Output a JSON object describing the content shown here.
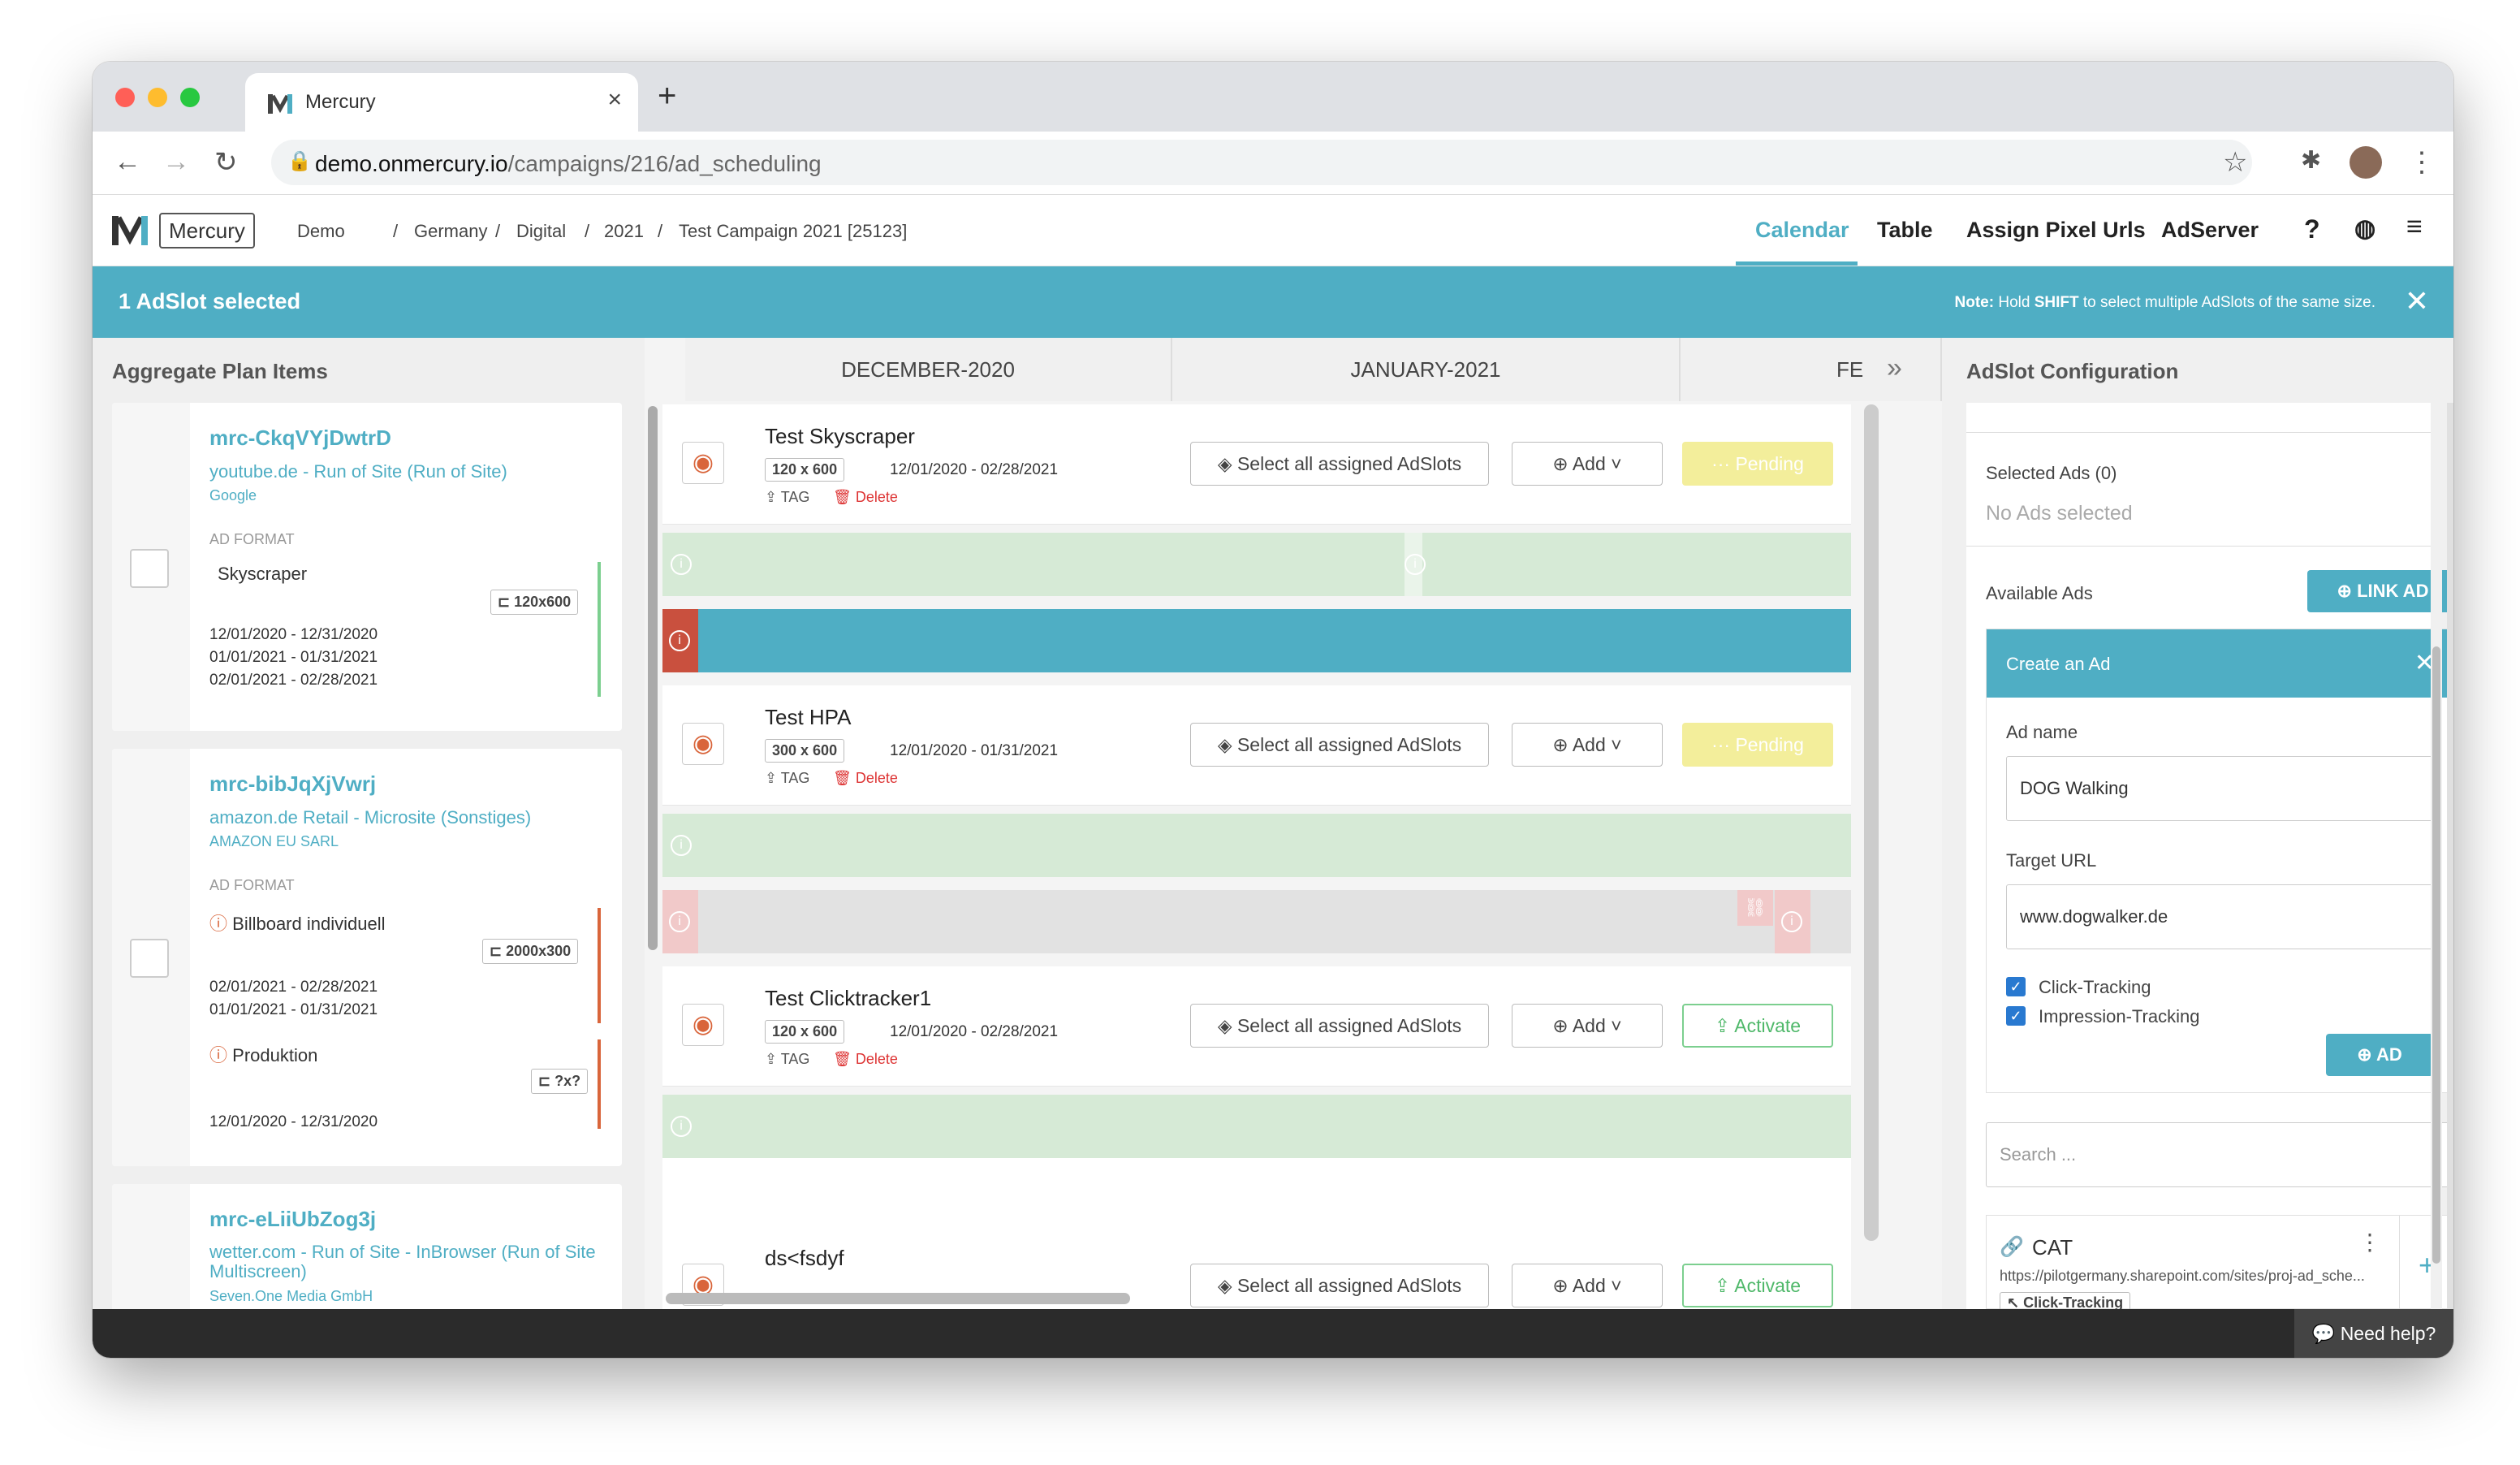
{
  "browser": {
    "tab_title": "Mercury",
    "url_domain": "demo.onmercury.io",
    "url_path": "/campaigns/216/ad_scheduling"
  },
  "app": {
    "logo_text": "Mercury",
    "breadcrumb": [
      "Demo",
      "Germany",
      "Digital",
      "2021",
      "Test Campaign 2021 [25123]"
    ],
    "nav": [
      "Calendar",
      "Table",
      "Assign Pixel Urls",
      "AdServer"
    ]
  },
  "banner": {
    "selected": "1 AdSlot selected",
    "note_label": "Note:",
    "note_pre": "Hold",
    "note_key": "SHIFT",
    "note_post": "to select multiple AdSlots of the same size."
  },
  "left": {
    "title": "Aggregate Plan Items",
    "items": [
      {
        "id": "mrc-CkqVYjDwtrD",
        "site": "youtube.de - Run of Site (Run of Site)",
        "owner": "Google",
        "format_label": "AD FORMAT",
        "format": "Skyscraper",
        "size": "120x600",
        "dates": [
          "12/01/2020 - 12/31/2020",
          "01/01/2021 - 01/31/2021",
          "02/01/2021 - 02/28/2021"
        ]
      },
      {
        "id": "mrc-bibJqXjVwrj",
        "site": "amazon.de Retail - Microsite (Sonstiges)",
        "owner": "AMAZON EU SARL",
        "format_label": "AD FORMAT",
        "format": "Billboard individuell",
        "size": "2000x300",
        "dates": [
          "02/01/2021 - 02/28/2021",
          "01/01/2021 - 01/31/2021"
        ],
        "format2": "Produktion",
        "size2": "?x?",
        "dates2": [
          "12/01/2020 - 12/31/2020"
        ]
      },
      {
        "id": "mrc-eLiiUbZog3j",
        "site": "wetter.com - Run of Site - InBrowser (Run of Site Multiscreen)",
        "owner": "Seven.One Media GmbH"
      }
    ]
  },
  "calendar": {
    "months": [
      "DECEMBER-2020",
      "JANUARY-2021",
      "FE"
    ],
    "rows": [
      {
        "name": "Test Skyscraper",
        "size": "120 x 600",
        "dates": "12/01/2020 - 02/28/2021",
        "status": "Pending"
      },
      {
        "name": "Test HPA",
        "size": "300 x 600",
        "dates": "12/01/2020 - 01/31/2021",
        "status": "Pending"
      },
      {
        "name": "Test Clicktracker1",
        "size": "120 x 600",
        "dates": "12/01/2020 - 02/28/2021",
        "status": "Activate"
      },
      {
        "name": "ds<fsdyf",
        "size": "",
        "dates": "",
        "status": "Activate"
      }
    ],
    "select_all": "Select all assigned AdSlots",
    "add": "Add",
    "tag": "TAG",
    "delete": "Delete"
  },
  "right": {
    "title": "AdSlot Configuration",
    "selected_ads": "Selected Ads (0)",
    "no_ads": "No Ads selected",
    "available_ads": "Available Ads",
    "link_ad": "LINK AD",
    "create_title": "Create an Ad",
    "ad_name_label": "Ad name",
    "ad_name": "DOG Walking",
    "target_label": "Target URL",
    "target_url": "www.dogwalker.de",
    "click_tracking": "Click-Tracking",
    "impression_tracking": "Impression-Tracking",
    "ad_btn": "AD",
    "search_placeholder": "Search ...",
    "ad_card_name": "CAT",
    "ad_card_url": "https://pilotgermany.sharepoint.com/sites/proj-ad_sche...",
    "ad_card_badge": "Click-Tracking"
  },
  "footer": {
    "help": "Need help?"
  },
  "colors": {
    "accent": "#4faec4",
    "pending": "#f3ee9b",
    "active_green": "#4fb86a",
    "scheduled": "#d6ead6",
    "error": "#d9534f"
  }
}
